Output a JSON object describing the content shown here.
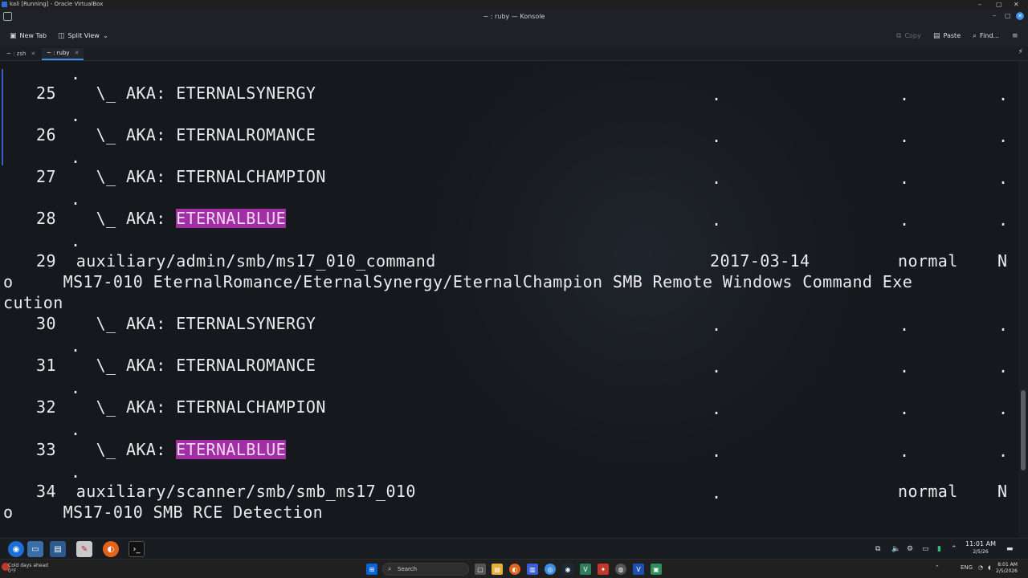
{
  "vbox": {
    "title": "kali [Running] - Oracle VirtualBox",
    "controls": [
      "–",
      "▢",
      "✕"
    ]
  },
  "konsole": {
    "title": "~ : ruby — Konsole",
    "controls": [
      "–",
      "▢",
      "✕"
    ]
  },
  "toolbar": {
    "new_tab": "New Tab",
    "split_view": "Split View",
    "copy": "Copy",
    "paste": "Paste",
    "find": "Find..."
  },
  "tabs": [
    {
      "label": "~ : zsh",
      "active": false
    },
    {
      "label": "~ : ruby",
      "active": true
    }
  ],
  "terminal": {
    "lines": {
      "l0": {
        "num": "25",
        "prefix": "\\_ AKA: ",
        "name": "ETERNALSYNERGY",
        "highlight": false
      },
      "l1": {
        "num": "26",
        "prefix": "\\_ AKA: ",
        "name": "ETERNALROMANCE",
        "highlight": false
      },
      "l2": {
        "num": "27",
        "prefix": "\\_ AKA: ",
        "name": "ETERNALCHAMPION",
        "highlight": false
      },
      "l3": {
        "num": "28",
        "prefix": "\\_ AKA: ",
        "name": "ETERNALBLUE",
        "highlight": true
      },
      "l5": {
        "num": "30",
        "prefix": "\\_ AKA: ",
        "name": "ETERNALSYNERGY",
        "highlight": false
      },
      "l6": {
        "num": "31",
        "prefix": "\\_ AKA: ",
        "name": "ETERNALROMANCE",
        "highlight": false
      },
      "l7": {
        "num": "32",
        "prefix": "\\_ AKA: ",
        "name": "ETERNALCHAMPION",
        "highlight": false
      },
      "l8": {
        "num": "33",
        "prefix": "\\_ AKA: ",
        "name": "ETERNALBLUE",
        "highlight": true
      }
    },
    "module29": {
      "num": "29",
      "path": "auxiliary/admin/smb/ms17_010_command",
      "date": "2017-03-14",
      "rank": "normal",
      "check": "N",
      "wrap1": "o     MS17-010 EternalRomance/EternalSynergy/EternalChampion SMB Remote Windows Command Exe",
      "wrap2": "cution"
    },
    "module34": {
      "num": "34",
      "path": "auxiliary/scanner/smb/smb_ms17_010",
      "date": ".",
      "rank": "normal",
      "check": "N",
      "wrap1": "o     MS17-010 SMB RCE Detection"
    },
    "dot": "."
  },
  "guest_taskbar": {
    "clock_time": "11:01 AM",
    "clock_date": "2/5/26"
  },
  "host_taskbar": {
    "weather_line1": "Cold days ahead",
    "weather_line2": "0°F",
    "search": "Search",
    "lang": "ENG",
    "clock_time": "8:01 AM",
    "clock_date": "2/5/2026"
  },
  "icons": {
    "new_tab": "terminal-plus-icon",
    "split_view": "split-view-icon",
    "copy": "copy-icon",
    "paste": "paste-icon",
    "find": "search-icon"
  },
  "colors": {
    "terminal_bg": "#15181c",
    "highlight_bg": "#a12ea4",
    "accent": "#3c8ee8"
  }
}
